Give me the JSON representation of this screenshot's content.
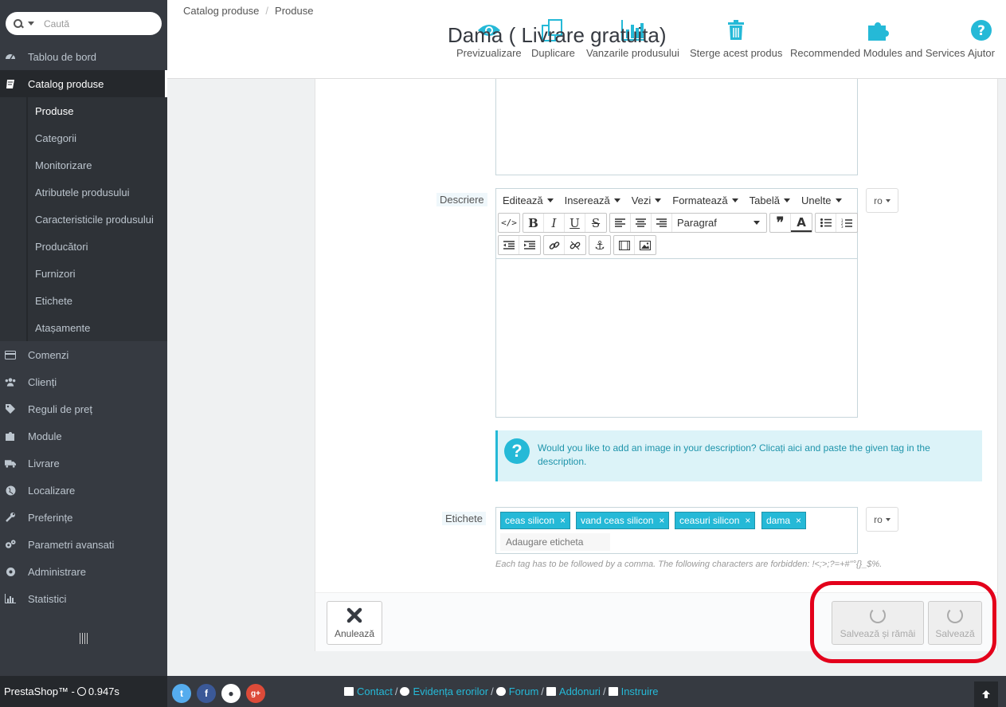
{
  "search": {
    "placeholder": "Caută"
  },
  "sidebar": {
    "items": [
      {
        "label": "Tablou de bord",
        "icon": "dashboard-icon"
      },
      {
        "label": "Catalog produse",
        "icon": "book-icon"
      },
      {
        "label": "Comenzi",
        "icon": "credit-card-icon"
      },
      {
        "label": "Clienți",
        "icon": "users-icon"
      },
      {
        "label": "Reguli de preț",
        "icon": "tags-icon"
      },
      {
        "label": "Module",
        "icon": "puzzle-icon"
      },
      {
        "label": "Livrare",
        "icon": "truck-icon"
      },
      {
        "label": "Localizare",
        "icon": "globe-icon"
      },
      {
        "label": "Preferințe",
        "icon": "wrench-icon"
      },
      {
        "label": "Parametri avansati",
        "icon": "cogs-icon"
      },
      {
        "label": "Administrare",
        "icon": "cog-icon"
      },
      {
        "label": "Statistici",
        "icon": "bar-chart-icon"
      }
    ],
    "catalog_sub": [
      "Produse",
      "Categorii",
      "Monitorizare",
      "Atributele produsului",
      "Caracteristicile produsului",
      "Producători",
      "Furnizori",
      "Etichete",
      "Atașamente"
    ]
  },
  "header": {
    "breadcrumb": [
      "Catalog produse",
      "Produse"
    ],
    "title": "Dama ( Livrare gratuita)",
    "toolbar": [
      "Previzualizare",
      "Duplicare",
      "Vanzarile produsului",
      "Sterge acest produs",
      "Recommended Modules and Services",
      "Ajutor"
    ]
  },
  "form": {
    "description_label": "Descriere",
    "editor_menu": [
      "Editează",
      "Inserează",
      "Vezi",
      "Formatează",
      "Tabelă",
      "Unelte"
    ],
    "format_select": "Paragraf",
    "lang": "ro",
    "alert_text": "Would you like to add an image in your description? Clicați aici and paste the given tag in the description.",
    "tags_label": "Etichete",
    "tags": [
      "ceas silicon",
      "vand ceas silicon",
      "ceasuri silicon",
      "dama"
    ],
    "tags_placeholder": "Adaugare eticheta",
    "tags_help": "Each tag has to be followed by a comma. The following characters are forbidden: !<;>;?=+#\"°{}_$%."
  },
  "actions": {
    "cancel": "Anulează",
    "save_stay": "Salvează și rămâi",
    "save": "Salvează"
  },
  "footer": {
    "brand": "PrestaShop™ - ",
    "time": "0.947s",
    "links": [
      "Contact",
      "Evidența erorilor",
      "Forum",
      "Addonuri",
      "Instruire"
    ],
    "separator": "/"
  },
  "colors": {
    "accent": "#25b9d7",
    "sidebar": "#363a41",
    "highlight": "#e3001b"
  }
}
